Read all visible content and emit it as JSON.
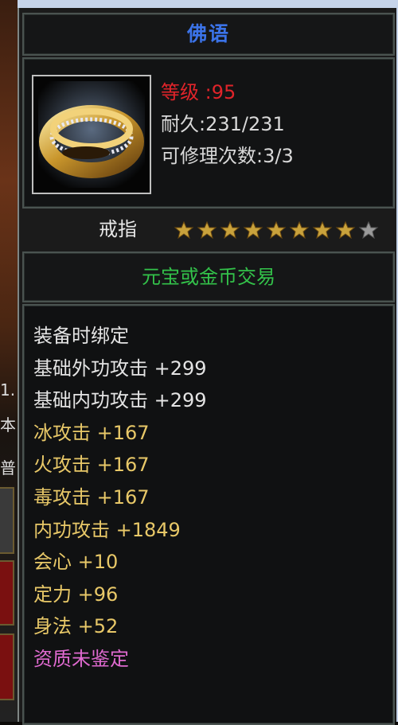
{
  "item": {
    "name": "佛语",
    "level_label": "等级 :95",
    "durability": "耐久:231/231",
    "repairs": "可修理次数:3/3",
    "type": "戒指",
    "stars": {
      "filled": 8,
      "total": 9
    },
    "trade": "元宝或金币交易",
    "icon": "gold-ring-icon"
  },
  "attributes": [
    {
      "text": "装备时绑定",
      "color": "white"
    },
    {
      "text": "基础外功攻击 +299",
      "color": "white"
    },
    {
      "text": "基础内功攻击 +299",
      "color": "white"
    },
    {
      "text": "冰攻击 +167",
      "color": "yellow"
    },
    {
      "text": "火攻击 +167",
      "color": "yellow"
    },
    {
      "text": "毒攻击 +167",
      "color": "yellow"
    },
    {
      "text": "内功攻击 +1849",
      "color": "yellow"
    },
    {
      "text": "会心 +10",
      "color": "yellow"
    },
    {
      "text": "定力 +96",
      "color": "yellow"
    },
    {
      "text": "身法 +52",
      "color": "yellow"
    },
    {
      "text": "资质未鉴定",
      "color": "pink"
    }
  ],
  "background_fragments": [
    "1.",
    "本",
    "普"
  ],
  "colors": {
    "title": "#3b73e8",
    "level": "#e0242a",
    "trade": "#33c24a",
    "attr_white": "#e4e4e4",
    "attr_yellow": "#e8c868",
    "attr_pink": "#e06ad0",
    "star_filled": "#c9a23c",
    "star_empty": "#9a9a9a"
  }
}
